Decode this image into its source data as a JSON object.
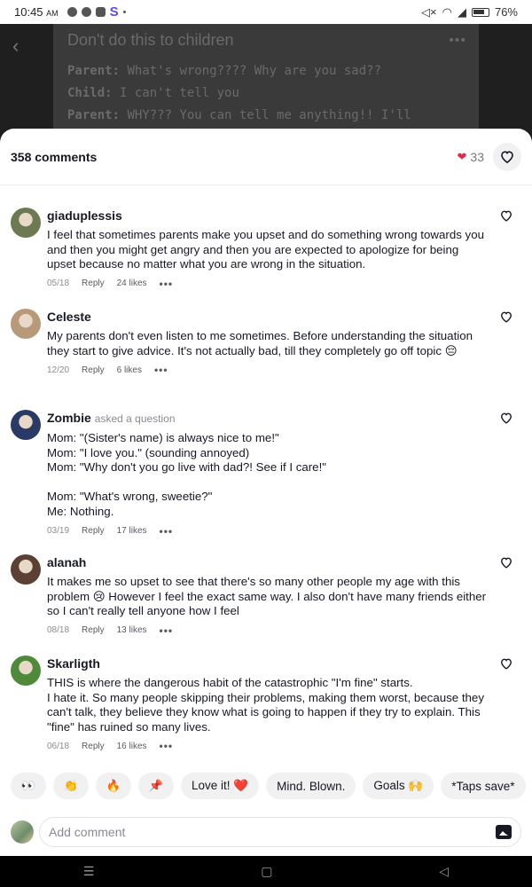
{
  "status_bar": {
    "time": "10:45",
    "ampm": "AM",
    "app_letter": "S",
    "battery": "76%"
  },
  "post": {
    "title": "Don't do this to children",
    "lines": [
      {
        "speaker": "Parent:",
        "text": " What's wrong???? Why are you sad??"
      },
      {
        "speaker": "Child:",
        "text": " I can't tell you"
      },
      {
        "speaker": "Parent:",
        "text": " WHY??? You can tell me anything!! I'll"
      }
    ]
  },
  "sheet": {
    "comment_count": "358 comments",
    "likes_count": "33"
  },
  "comments": [
    {
      "username": "giaduplessis",
      "asked": "",
      "text": "I feel that sometimes parents make you upset and do something wrong towards you and then you might get angry and then you are expected to apologize for being upset because no matter what you are wrong in the situation.",
      "date": "05/18",
      "reply": "Reply",
      "likes": "24 likes",
      "avatar_color": "#6b7a52"
    },
    {
      "username": "Celeste",
      "asked": "",
      "text": "My parents don't even listen to me sometimes. Before understanding the situation they start to give advice. It's not actually bad, till they completely go off topic 😔",
      "date": "12/20",
      "reply": "Reply",
      "likes": "6 likes",
      "avatar_color": "#b89a7a"
    },
    {
      "username": "Zombie",
      "asked": "asked a question",
      "text": "Mom: \"(Sister's name) is always nice to me!\"\nMom: \"I love you.\" (sounding annoyed)\nMom: \"Why don't you go live with dad?! See if I care!\"\n\nMom: \"What's wrong, sweetie?\"\nMe: Nothing.",
      "date": "03/19",
      "reply": "Reply",
      "likes": "17 likes",
      "avatar_color": "#2a3a66"
    },
    {
      "username": "alanah",
      "asked": "",
      "text": "It makes me so upset to see that there's so many other people my age with this problem 😢 However I feel the exact same way. I also don't have many friends either so I can't really tell anyone how I feel",
      "date": "08/18",
      "reply": "Reply",
      "likes": "13 likes",
      "avatar_color": "#5c4034"
    },
    {
      "username": "Skarligth",
      "asked": "",
      "text": "THIS is where the dangerous habit of the catastrophic \"I'm fine\" starts.\n I hate it. So many people skipping their problems, making them worst, because they can't talk, they believe they know what is going to happen if they try to explain. This \"fine\" has ruined so many lives.",
      "date": "06/18",
      "reply": "Reply",
      "likes": "16 likes",
      "avatar_color": "#4f8a3a"
    }
  ],
  "quick_reactions": [
    "👀",
    "👏",
    "🔥",
    "📌",
    "Love it! ❤️",
    "Mind. Blown.",
    "Goals 🙌",
    "*Taps save*"
  ],
  "input": {
    "placeholder": "Add comment"
  }
}
